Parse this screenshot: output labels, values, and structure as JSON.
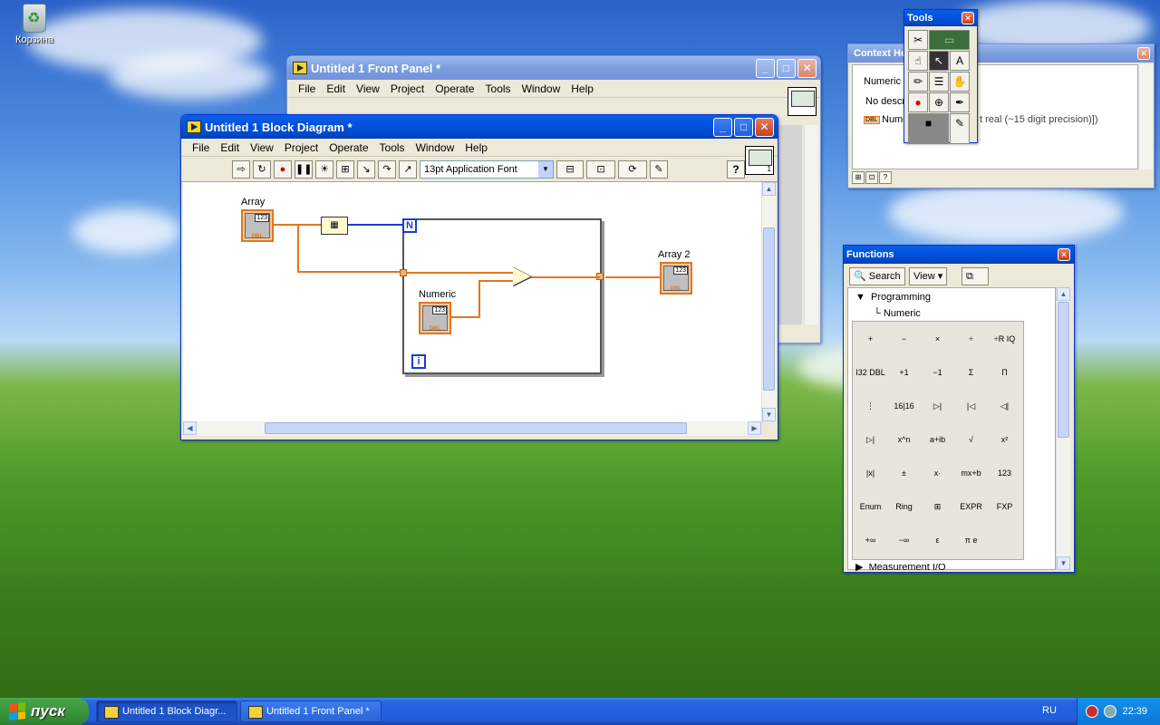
{
  "desktop": {
    "recycle_bin_label": "Корзина"
  },
  "front_panel": {
    "title": "Untitled 1 Front Panel *",
    "menu": [
      "File",
      "Edit",
      "View",
      "Project",
      "Operate",
      "Tools",
      "Window",
      "Help"
    ],
    "font": "13pt Application Font"
  },
  "block_diagram": {
    "title": "Untitled 1 Block Diagram *",
    "menu": [
      "File",
      "Edit",
      "View",
      "Project",
      "Operate",
      "Tools",
      "Window",
      "Help"
    ],
    "font": "13pt Application Font",
    "vi_icon_label": "1",
    "nodes": {
      "array_label": "Array",
      "numeric_label": "Numeric",
      "array2_label": "Array 2",
      "n_terminal": "N",
      "i_terminal": "i",
      "num_glyph": "123",
      "dbl_glyph": "DBL"
    }
  },
  "context_help": {
    "title": "Context He",
    "line1": "Numeric",
    "line2": "No descri",
    "line3_prefix": "Nume",
    "line3_suffix": "t real (~15 digit precision)])",
    "badge": "DBL"
  },
  "tools": {
    "title": "Tools"
  },
  "functions": {
    "title": "Functions",
    "search_label": "Search",
    "view_label": "View",
    "tree_root": "Programming",
    "tree_child": "Numeric",
    "tree_next": "Measurement I/O",
    "palette": [
      "+",
      "−",
      "×",
      "÷",
      "÷R IQ",
      "I32 DBL",
      "+1",
      "−1",
      "Σ",
      "Π",
      "⋮",
      "16|16",
      "▷|",
      "|◁",
      "◁|",
      "▷|",
      "x^n",
      "a+ib",
      "√",
      "x²",
      "|x|",
      "±",
      "x·",
      "mx+b",
      "123",
      "Enum",
      "Ring",
      "⊞",
      "EXPR",
      "FXP",
      "+∞",
      "−∞",
      "ε",
      "π e"
    ]
  },
  "taskbar": {
    "start_label": "пуск",
    "tasks": [
      "Untitled 1 Block Diagr...",
      "Untitled 1 Front Panel *"
    ],
    "lang": "RU",
    "clock": "22:39"
  }
}
